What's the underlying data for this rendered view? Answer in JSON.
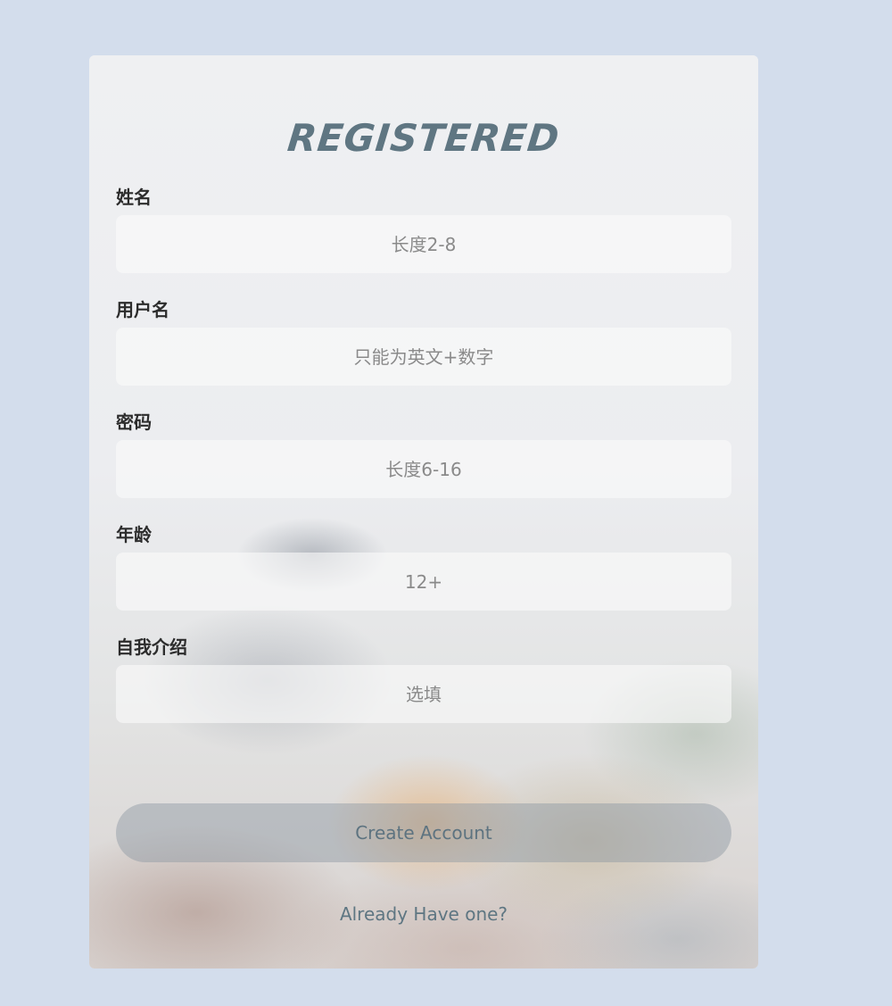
{
  "form": {
    "title": "REGISTERED",
    "fields": [
      {
        "label": "姓名",
        "placeholder": "长度2-8",
        "value": ""
      },
      {
        "label": "用户名",
        "placeholder": "只能为英文+数字",
        "value": ""
      },
      {
        "label": "密码",
        "placeholder": "长度6-16",
        "value": ""
      },
      {
        "label": "年龄",
        "placeholder": "12+",
        "value": ""
      },
      {
        "label": "自我介绍",
        "placeholder": "选填",
        "value": ""
      }
    ],
    "submit_label": "Create Account",
    "login_link": "Already Have one?"
  },
  "colors": {
    "page_background": "#d3ddec",
    "accent": "#5f7682",
    "label_text": "#2c2c2c",
    "placeholder_text": "#8a8a8a"
  }
}
